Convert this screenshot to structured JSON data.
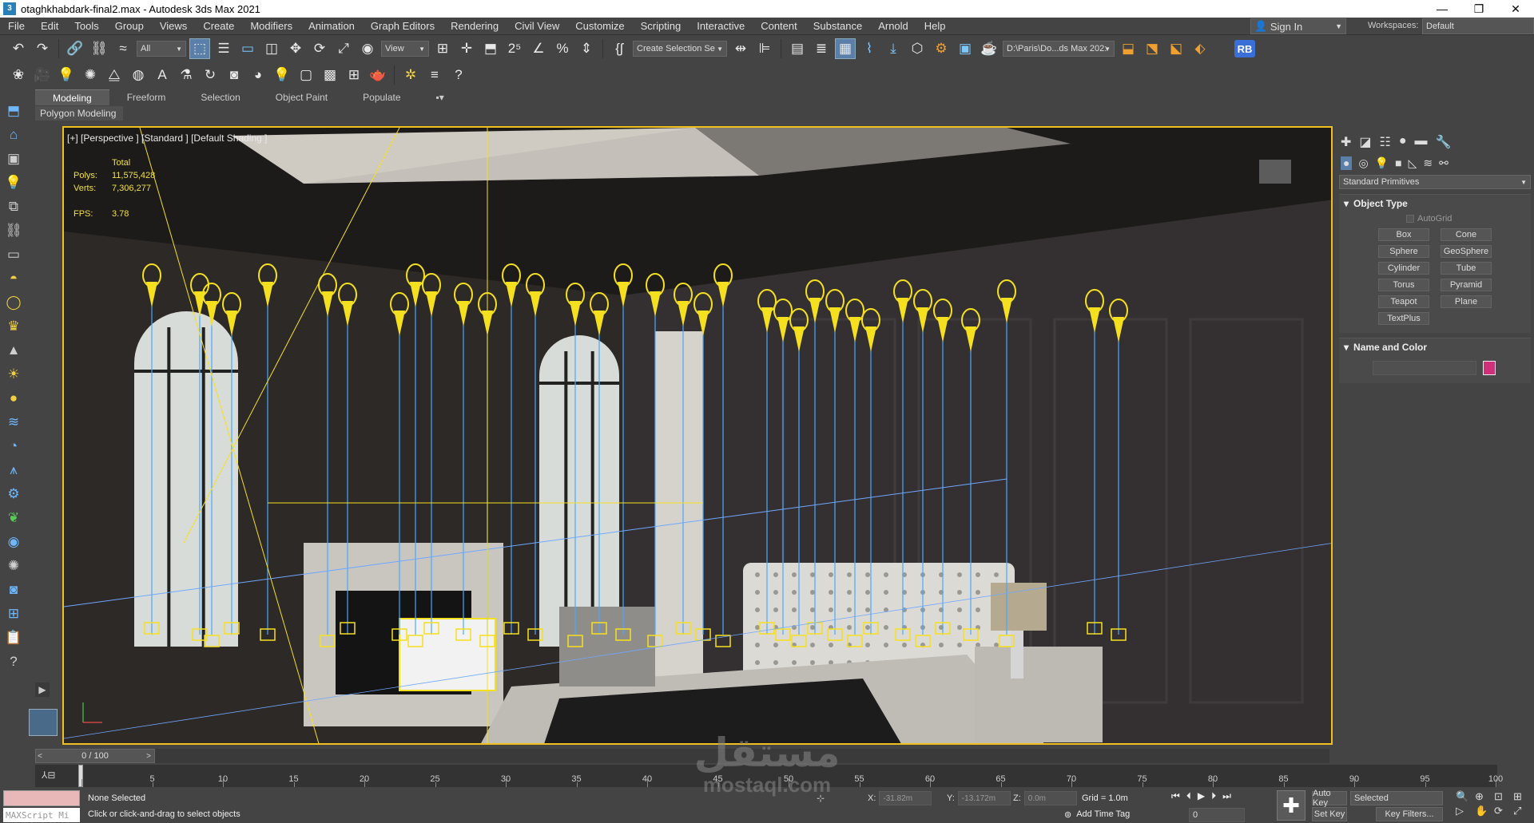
{
  "window": {
    "title": "otaghkhabdark-final2.max - Autodesk 3ds Max 2021",
    "minimize": "—",
    "maximize": "❐",
    "close": "✕"
  },
  "menu": {
    "items": [
      "File",
      "Edit",
      "Tools",
      "Group",
      "Views",
      "Create",
      "Modifiers",
      "Animation",
      "Graph Editors",
      "Rendering",
      "Civil View",
      "Customize",
      "Scripting",
      "Interactive",
      "Content",
      "Substance",
      "Arnold",
      "Help"
    ],
    "sign_in": "Sign In",
    "workspaces_label": "Workspaces:",
    "workspace": "Default"
  },
  "toolbar": {
    "filter": "All",
    "view": "View",
    "selection_set": "Create Selection Se",
    "project_path": "D:\\Paris\\Do...ds Max 202:",
    "rb_badge": "RB"
  },
  "ribbon": {
    "tabs": [
      "Modeling",
      "Freeform",
      "Selection",
      "Object Paint",
      "Populate"
    ],
    "active_tab": "Modeling",
    "subpanel": "Polygon Modeling"
  },
  "viewport": {
    "label": "[+] [Perspective ] [Standard ] [Default Shading ]",
    "stats": {
      "total_label": "Total",
      "polys_label": "Polys:",
      "polys": "11,575,428",
      "verts_label": "Verts:",
      "verts": "7,306,277",
      "fps_label": "FPS:",
      "fps": "3.78"
    },
    "colors": {
      "selection_border": "#f0c020",
      "light_helpers": "#f5e020",
      "target_lines": "#4aa8ff"
    }
  },
  "command_panel": {
    "category": "Standard Primitives",
    "object_type_title": "Object Type",
    "autogrid": "AutoGrid",
    "primitives": [
      "Box",
      "Cone",
      "Sphere",
      "GeoSphere",
      "Cylinder",
      "Tube",
      "Torus",
      "Pyramid",
      "Teapot",
      "Plane",
      "TextPlus"
    ],
    "name_color_title": "Name and Color",
    "color": "#d0307a"
  },
  "timeline": {
    "slider": "0 / 100",
    "ticks": [
      "5",
      "10",
      "15",
      "20",
      "25",
      "30",
      "35",
      "40",
      "45",
      "50",
      "55",
      "60",
      "65",
      "70",
      "75",
      "80",
      "85",
      "90",
      "95",
      "100"
    ]
  },
  "status": {
    "maxscript": "MAXScript Mi",
    "selection": "None Selected",
    "prompt": "Click or click-and-drag to select objects",
    "x_label": "X:",
    "x": "-31.82m",
    "y_label": "Y:",
    "y": "-13.172m",
    "z_label": "Z:",
    "z": "0.0m",
    "grid": "Grid = 1.0m",
    "add_time_tag": "Add Time Tag",
    "frame": "0",
    "auto_key": "Auto Key",
    "set_key": "Set Key",
    "key_mode": "Selected",
    "key_filters": "Key Filters..."
  },
  "watermark": {
    "arabic": "مستقل",
    "latin": "mostaql.com"
  }
}
